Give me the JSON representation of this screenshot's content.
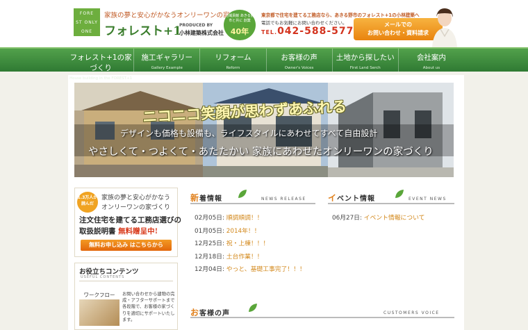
{
  "header": {
    "logo_text": "FOREST ONLY ONE",
    "tagline": "家族の夢と安心がかなうオンリーワンの家づくり",
    "brand_name": "フォレスト+1",
    "produced_by": "PRODUCED BY",
    "company_name": "小林建築株式会社",
    "anniversary_small": "地域貢献 あきる野市と共に 創業",
    "anniversary_big": "40年",
    "tel_description": "東京都で住宅を建てる工務店なら、あきる野市のフォレスト+1の小林建築へ",
    "tel_description2": "電話でもお気軽にお問い合わせください。",
    "tel_prefix": "TEL.",
    "tel_number": "042-588-5776",
    "contact_line1": "メールでの",
    "contact_line2": "お問い合わせ・資料請求"
  },
  "nav": [
    {
      "label": "フォレスト+1の家づくり",
      "sub": "House building in the FOREST+1"
    },
    {
      "label": "施工ギャラリー",
      "sub": "Gallery Example"
    },
    {
      "label": "リフォーム",
      "sub": "Reform"
    },
    {
      "label": "お客様の声",
      "sub": "Owner's Voices"
    },
    {
      "label": "土地から探したい",
      "sub": "First Land Serch"
    },
    {
      "label": "会社案内",
      "sub": "About us"
    }
  ],
  "hero": {
    "headline": "ニコニコ笑顔が思わずあふれる",
    "line1": "デザインも価格も設備も、ライフスタイルにあわせてすべて自由設計",
    "line2": "やさしくて・つよくて・あたたかい 家族にあわせたオンリーワンの家づくり"
  },
  "promo": {
    "seal": "1.3万人が読んだ",
    "line1": "家族の夢と安心がかなう",
    "line2": "オンリーワンの家づくり",
    "line3": "注文住宅を建てる工務店選びの",
    "line4_a": "取扱説明書",
    "line4_b": "無料贈呈中!",
    "button": "無料お申し込み はこちらから"
  },
  "useful": {
    "title": "お役立ちコンテンツ",
    "sub": "USEFUL CONTENTS",
    "item_label": "ワークフロー",
    "item_desc": "お問い合わせから建物の完成・アフターサポートまで各段階で、お客様の家づくりを適切にサポートいたします。"
  },
  "news": {
    "title_first": "新",
    "title_rest": "着情報",
    "sub": "NEWS RELEASE",
    "items": [
      {
        "date": "02月05日:",
        "title": "順調順調！！"
      },
      {
        "date": "01月05日:",
        "title": "2014年！！"
      },
      {
        "date": "12月25日:",
        "title": "祝・上棟！！！"
      },
      {
        "date": "12月18日:",
        "title": "土台作業！！"
      },
      {
        "date": "12月04日:",
        "title": "やっと、基礎工事完了！！！"
      }
    ]
  },
  "events": {
    "title_first": "イ",
    "title_rest": "ベント情報",
    "sub": "EVENT NEWS",
    "items": [
      {
        "date": "06月27日:",
        "title": "イベント情報について"
      }
    ]
  },
  "voices": {
    "title_first": "お",
    "title_rest": "客様の声",
    "sub": "CUSTOMERS VOICE"
  },
  "colors": {
    "nav_green": "#3f8b3e",
    "accent_orange": "#e0801c",
    "tel_red": "#d3341f"
  }
}
